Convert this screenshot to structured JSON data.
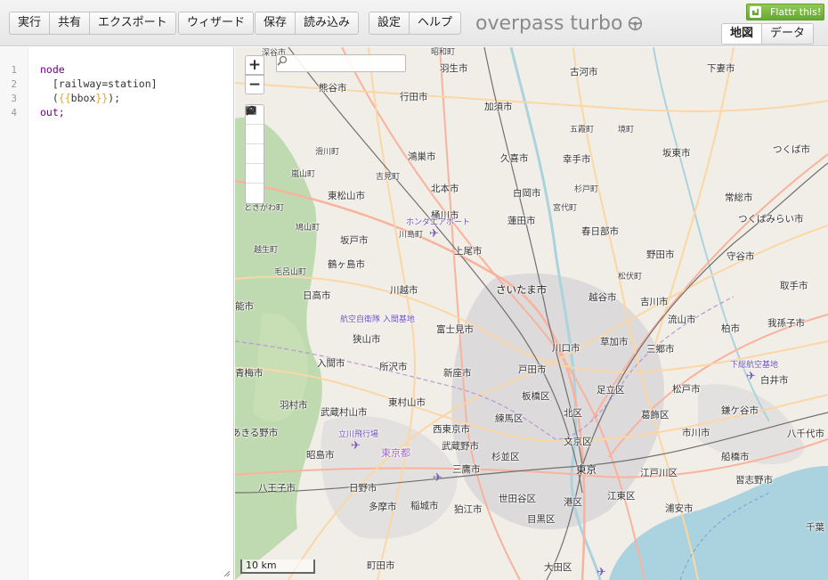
{
  "toolbar": {
    "run": "実行",
    "share": "共有",
    "export": "エクスポート",
    "wizard": "ウィザード",
    "save": "保存",
    "load": "読み込み",
    "settings": "設定",
    "help": "ヘルプ"
  },
  "brand": {
    "title": "overpass turbo"
  },
  "flattr": {
    "label": "Flattr this!"
  },
  "view_tabs": {
    "map": "地図",
    "data": "データ",
    "active": "map"
  },
  "editor": {
    "line_numbers": [
      "1",
      "2",
      "3",
      "4"
    ],
    "lines": {
      "l1": "node",
      "l2": "  [railway=station]",
      "l3_open": "  (",
      "l3_tpl_open": "{{",
      "l3_tpl_name": "bbox",
      "l3_tpl_close": "}}",
      "l3_close": ");",
      "l4": "out;"
    }
  },
  "map": {
    "search": {
      "placeholder": "",
      "value": ""
    },
    "zoom_in": "+",
    "zoom_out": "−",
    "scale_label": "10 km",
    "colors": {
      "land": "#f1eee8",
      "urban": "#e0dfdf",
      "forest": "#add19e",
      "water": "#aad3df",
      "primary_road": "#fcd6a4",
      "trunk_road": "#f9b29c",
      "railway": "#707070",
      "label_purple": "#6b4fb3"
    },
    "places": [
      {
        "name": "深谷市",
        "cls": "small"
      },
      {
        "name": "昭和町",
        "cls": "small"
      },
      {
        "name": "羽生市",
        "cls": ""
      },
      {
        "name": "古河市",
        "cls": ""
      },
      {
        "name": "下妻市",
        "cls": ""
      },
      {
        "name": "熊谷市",
        "cls": ""
      },
      {
        "name": "行田市",
        "cls": ""
      },
      {
        "name": "加須市",
        "cls": ""
      },
      {
        "name": "五霞町",
        "cls": "small"
      },
      {
        "name": "境町",
        "cls": "small"
      },
      {
        "name": "つくば市",
        "cls": ""
      },
      {
        "name": "滑川町",
        "cls": "small"
      },
      {
        "name": "鴻巣市",
        "cls": ""
      },
      {
        "name": "久喜市",
        "cls": ""
      },
      {
        "name": "幸手市",
        "cls": ""
      },
      {
        "name": "坂東市",
        "cls": ""
      },
      {
        "name": "嵐山町",
        "cls": "small"
      },
      {
        "name": "吉見町",
        "cls": "small"
      },
      {
        "name": "北本市",
        "cls": ""
      },
      {
        "name": "杉戸町",
        "cls": "small"
      },
      {
        "name": "東松山市",
        "cls": ""
      },
      {
        "name": "白岡市",
        "cls": ""
      },
      {
        "name": "常総市",
        "cls": ""
      },
      {
        "name": "ときがわ町",
        "cls": "small"
      },
      {
        "name": "宮代町",
        "cls": "small"
      },
      {
        "name": "桶川市",
        "cls": ""
      },
      {
        "name": "蓮田市",
        "cls": ""
      },
      {
        "name": "つくばみらい市",
        "cls": ""
      },
      {
        "name": "鳩山町",
        "cls": "small"
      },
      {
        "name": "川島町",
        "cls": "small"
      },
      {
        "name": "春日部市",
        "cls": ""
      },
      {
        "name": "坂戸市",
        "cls": ""
      },
      {
        "name": "上尾市",
        "cls": ""
      },
      {
        "name": "越生町",
        "cls": "small"
      },
      {
        "name": "野田市",
        "cls": ""
      },
      {
        "name": "守谷市",
        "cls": ""
      },
      {
        "name": "鶴ヶ島市",
        "cls": ""
      },
      {
        "name": "毛呂山町",
        "cls": "small"
      },
      {
        "name": "松伏町",
        "cls": "small"
      },
      {
        "name": "日高市",
        "cls": ""
      },
      {
        "name": "川越市",
        "cls": ""
      },
      {
        "name": "さいたま市",
        "cls": "big"
      },
      {
        "name": "越谷市",
        "cls": ""
      },
      {
        "name": "吉川市",
        "cls": ""
      },
      {
        "name": "取手市",
        "cls": ""
      },
      {
        "name": "能市",
        "cls": ""
      },
      {
        "name": "流山市",
        "cls": ""
      },
      {
        "name": "我孫子市",
        "cls": ""
      },
      {
        "name": "富士見市",
        "cls": ""
      },
      {
        "name": "柏市",
        "cls": ""
      },
      {
        "name": "狭山市",
        "cls": ""
      },
      {
        "name": "川口市",
        "cls": ""
      },
      {
        "name": "草加市",
        "cls": ""
      },
      {
        "name": "三郷市",
        "cls": ""
      },
      {
        "name": "入間市",
        "cls": ""
      },
      {
        "name": "所沢市",
        "cls": ""
      },
      {
        "name": "新座市",
        "cls": ""
      },
      {
        "name": "戸田市",
        "cls": ""
      },
      {
        "name": "白井市",
        "cls": ""
      },
      {
        "name": "青梅市",
        "cls": ""
      },
      {
        "name": "板橋区",
        "cls": ""
      },
      {
        "name": "足立区",
        "cls": ""
      },
      {
        "name": "松戸市",
        "cls": ""
      },
      {
        "name": "羽村市",
        "cls": ""
      },
      {
        "name": "東村山市",
        "cls": ""
      },
      {
        "name": "北区",
        "cls": ""
      },
      {
        "name": "鎌ケ谷市",
        "cls": ""
      },
      {
        "name": "武蔵村山市",
        "cls": ""
      },
      {
        "name": "練馬区",
        "cls": ""
      },
      {
        "name": "葛飾区",
        "cls": ""
      },
      {
        "name": "あきる野市",
        "cls": ""
      },
      {
        "name": "西東京市",
        "cls": ""
      },
      {
        "name": "文京区",
        "cls": ""
      },
      {
        "name": "市川市",
        "cls": ""
      },
      {
        "name": "八千代市",
        "cls": ""
      },
      {
        "name": "武蔵野市",
        "cls": ""
      },
      {
        "name": "昭島市",
        "cls": ""
      },
      {
        "name": "杉並区",
        "cls": ""
      },
      {
        "name": "船橋市",
        "cls": ""
      },
      {
        "name": "三鷹市",
        "cls": ""
      },
      {
        "name": "東京",
        "cls": "big"
      },
      {
        "name": "江戸川区",
        "cls": ""
      },
      {
        "name": "八王子市",
        "cls": ""
      },
      {
        "name": "日野市",
        "cls": ""
      },
      {
        "name": "習志野市",
        "cls": ""
      },
      {
        "name": "世田谷区",
        "cls": ""
      },
      {
        "name": "江東区",
        "cls": ""
      },
      {
        "name": "多摩市",
        "cls": ""
      },
      {
        "name": "稲城市",
        "cls": ""
      },
      {
        "name": "狛江市",
        "cls": ""
      },
      {
        "name": "港区",
        "cls": ""
      },
      {
        "name": "浦安市",
        "cls": ""
      },
      {
        "name": "目黒区",
        "cls": ""
      },
      {
        "name": "千葉",
        "cls": ""
      },
      {
        "name": "町田市",
        "cls": ""
      },
      {
        "name": "大田区",
        "cls": ""
      }
    ],
    "pois": [
      {
        "name": "ホンダエアポート",
        "cls": "blue"
      },
      {
        "name": "航空自衛隊 入間基地",
        "cls": "blue"
      },
      {
        "name": "下総航空基地",
        "cls": "blue"
      },
      {
        "name": "立川飛行場",
        "cls": "blue"
      },
      {
        "name": "東京都",
        "cls": "pref"
      }
    ]
  }
}
